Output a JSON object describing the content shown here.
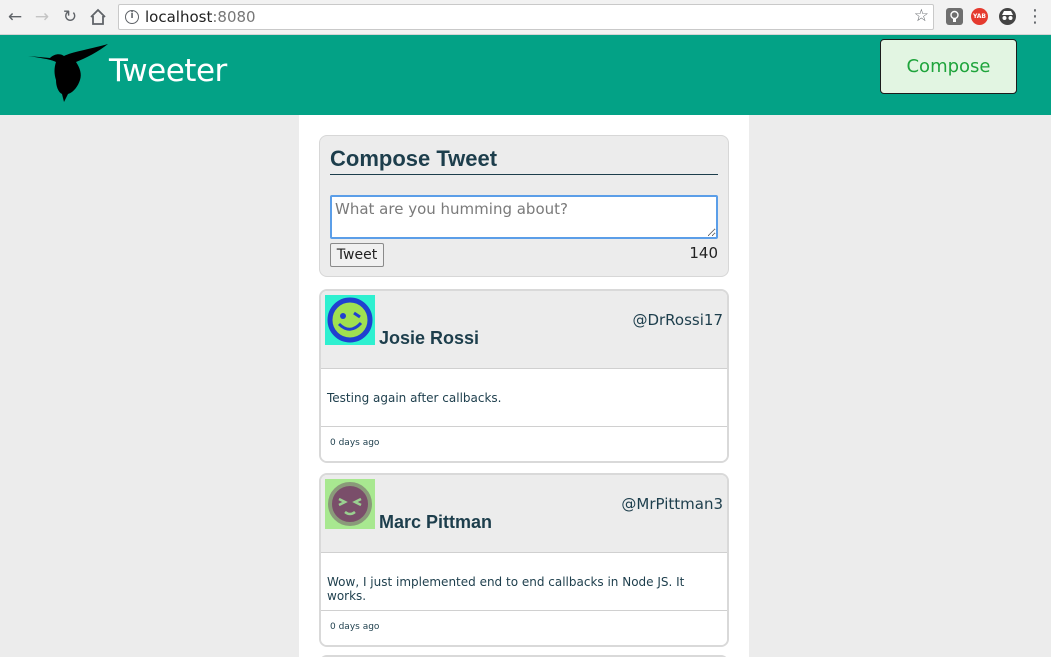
{
  "browser": {
    "url_host": "localhost",
    "url_port": ":8080",
    "extensions": [
      {
        "name": "lightbulb-extension-icon",
        "text": ""
      },
      {
        "name": "yab-extension-icon",
        "text": "YAB"
      },
      {
        "name": "incognito-extension-icon",
        "text": ""
      }
    ]
  },
  "header": {
    "title": "Tweeter",
    "compose_label": "Compose",
    "logo": "hummingbird-icon"
  },
  "compose": {
    "heading": "Compose Tweet",
    "placeholder": "What are you humming about?",
    "value": "",
    "button_label": "Tweet",
    "counter": "140"
  },
  "tweets": [
    {
      "name": "Josie Rossi",
      "handle": "@DrRossi17",
      "body": "Testing again after callbacks.",
      "time": "0 days ago",
      "avatar_bg": "#2ef0d0",
      "avatar_fg": "#a0e050"
    },
    {
      "name": "Marc Pittman",
      "handle": "@MrPittman3",
      "body": "Wow, I just implemented end to end callbacks in Node JS. It works.",
      "time": "0 days ago",
      "avatar_bg": "#a8e890",
      "avatar_fg": "#7a4e6a"
    }
  ],
  "colors": {
    "header_bg": "#03a286",
    "text_dark": "#1d3e4c",
    "compose_text": "#1fa43c"
  }
}
